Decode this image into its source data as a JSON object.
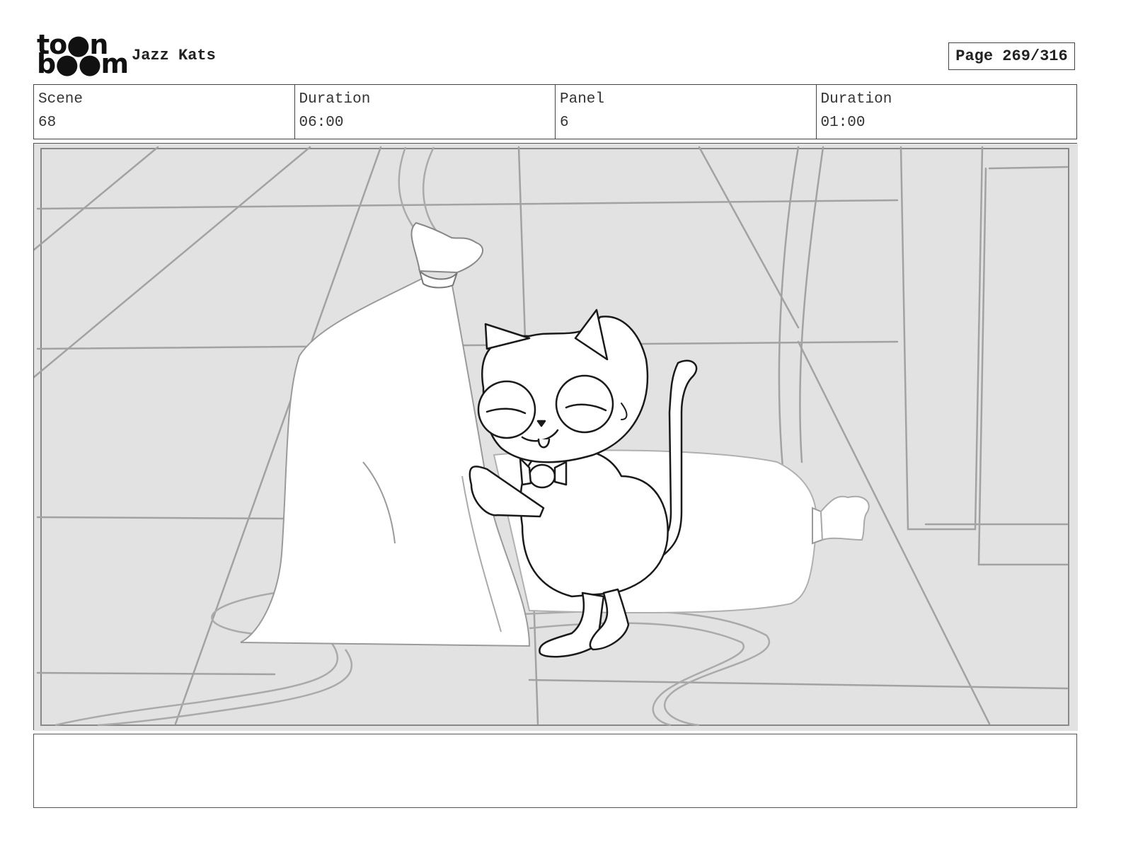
{
  "logo": {
    "line1": "to●n",
    "line2": "b●●m"
  },
  "header": {
    "project_title": "Jazz Kats",
    "page_label": "Page 269/316"
  },
  "info": {
    "scene_label": "Scene",
    "scene_value": "68",
    "duration_label": "Duration",
    "duration_value": "06:00",
    "panel_label": "Panel",
    "panel_value": "6",
    "panel_duration_label": "Duration",
    "panel_duration_value": "01:00"
  },
  "panel": {
    "subjects": [
      "cat-icon",
      "sack-icon",
      "rope-icon"
    ],
    "colors": {
      "background": "#e2e2e2",
      "sketch": "#9a9a9a",
      "ink": "#1a1a1a"
    }
  },
  "notes": {
    "text": ""
  }
}
